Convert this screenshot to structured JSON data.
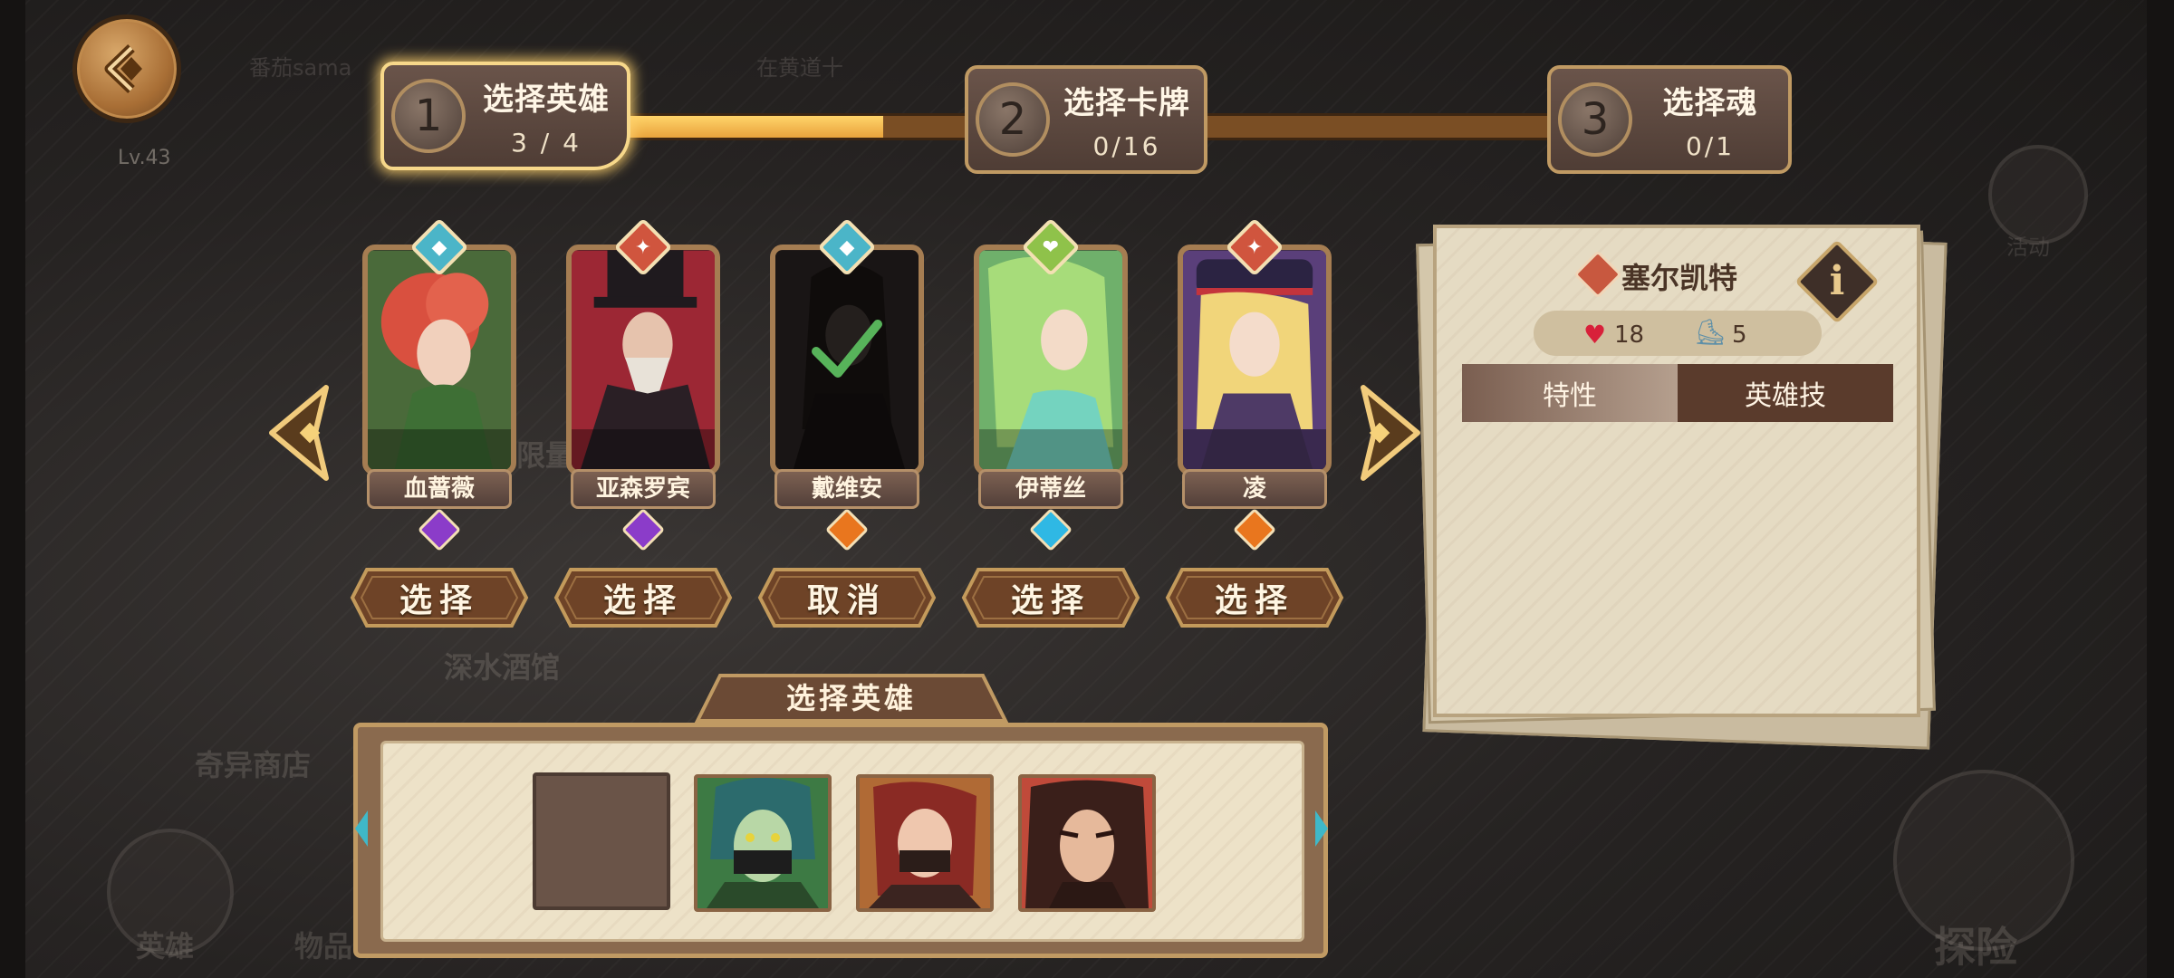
{
  "background": {
    "player_name": "番茄sama",
    "status_text": "在黄道十",
    "player_level": "Lv.43",
    "limit_text": "限量",
    "tavern": "深水酒馆",
    "shop": "奇异商店",
    "event": "活动",
    "nav_heroes": "英雄",
    "nav_items": "物品",
    "explore": "探险"
  },
  "steps": [
    {
      "num": "1",
      "title": "选择英雄",
      "count": "3 / 4",
      "active": true
    },
    {
      "num": "2",
      "title": "选择卡牌",
      "count": "0/16",
      "active": false
    },
    {
      "num": "3",
      "title": "选择魂",
      "count": "0/1",
      "active": false
    }
  ],
  "progress": {
    "fraction": 0.28
  },
  "heroes": [
    {
      "name": "血蔷薇",
      "class_icon": "shield-icon",
      "class_color": "#4bb5c8",
      "gem": "purple",
      "button": "选择"
    },
    {
      "name": "亚森罗宾",
      "class_icon": "dagger-icon",
      "class_color": "#d0553e",
      "gem": "purple",
      "button": "选择"
    },
    {
      "name": "戴维安",
      "class_icon": "shield-icon",
      "class_color": "#4bb5c8",
      "gem": "orange",
      "button": "取消"
    },
    {
      "name": "伊蒂丝",
      "class_icon": "heal-icon",
      "class_color": "#8fc24a",
      "gem": "cyan",
      "button": "选择"
    },
    {
      "name": "凌",
      "class_icon": "dagger-icon",
      "class_color": "#d0553e",
      "gem": "orange",
      "button": "选择"
    }
  ],
  "selection": {
    "title": "选择英雄"
  },
  "info": {
    "hero_name": "塞尔凯特",
    "hp": "18",
    "speed": "5",
    "tab_traits": "特性",
    "tab_skill": "英雄技",
    "info_button": "i"
  },
  "colors": {
    "gold": "#f7d88a",
    "panel_brown": "#8a6a4e",
    "parchment": "#e5dbc3"
  }
}
